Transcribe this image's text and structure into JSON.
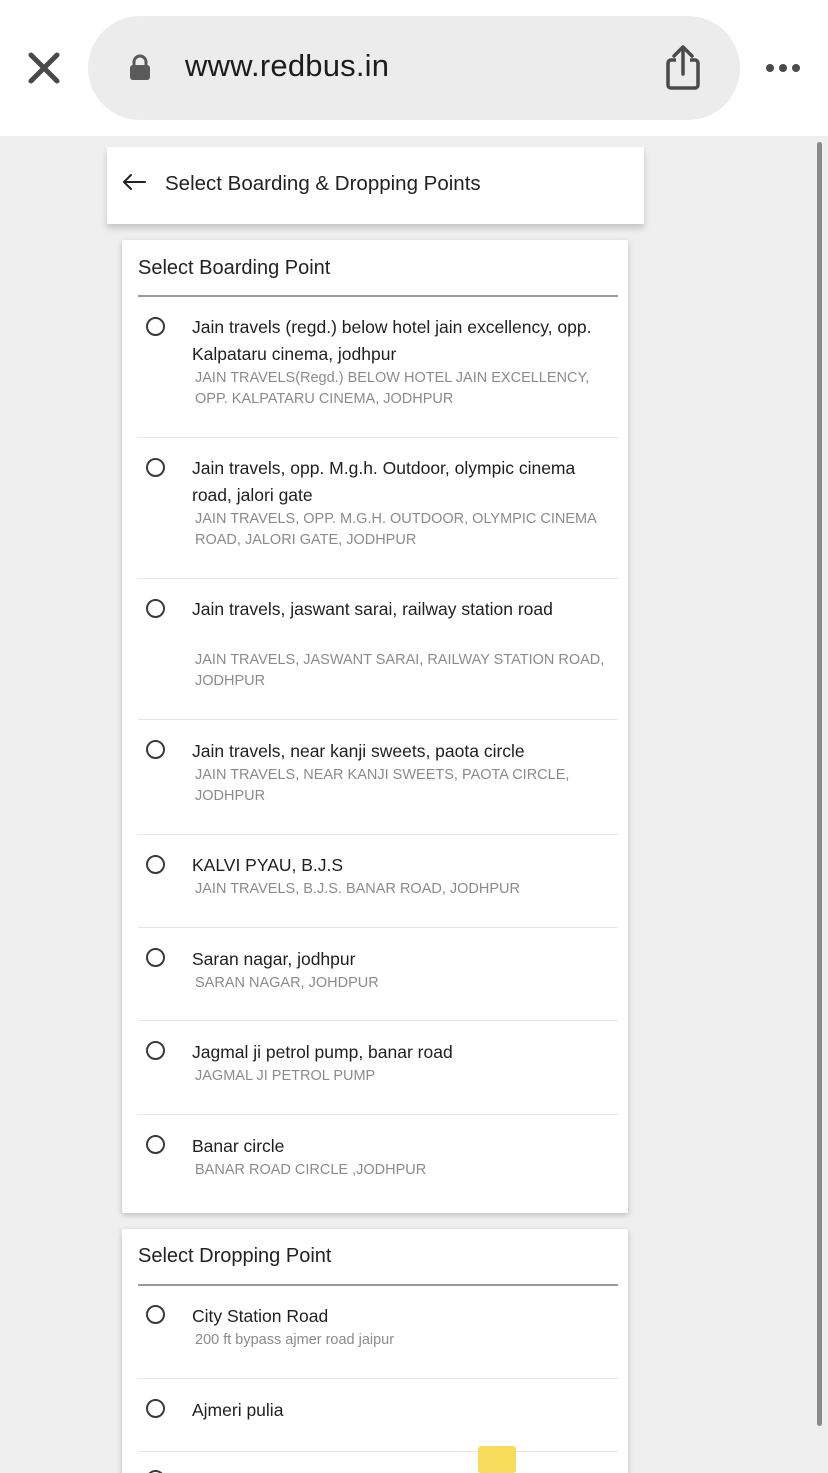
{
  "browser": {
    "url": "www.redbus.in",
    "icons": [
      "close-icon",
      "lock-icon",
      "share-icon",
      "more-icon"
    ]
  },
  "header": {
    "title": "Select Boarding & Dropping Points",
    "back_icon": "arrow-left-icon"
  },
  "boarding": {
    "title": "Select Boarding Point",
    "points": [
      {
        "name": "Jain travels (regd.) below hotel jain excellency, opp. Kalpataru cinema, jodhpur",
        "address": "JAIN TRAVELS(Regd.) BELOW HOTEL JAIN EXCELLENCY, OPP. KALPATARU CINEMA, JODHPUR"
      },
      {
        "name": "Jain travels, opp. M.g.h. Outdoor, olympic cinema road, jalori gate",
        "address": "JAIN TRAVELS, OPP. M.G.H. OUTDOOR, OLYMPIC CINEMA ROAD, JALORI GATE, JODHPUR"
      },
      {
        "name": "Jain travels, jaswant sarai, railway station road",
        "address": "JAIN TRAVELS, JASWANT SARAI, RAILWAY STATION ROAD, JODHPUR"
      },
      {
        "name": "Jain travels, near kanji sweets, paota circle",
        "address": "JAIN TRAVELS, NEAR KANJI SWEETS, PAOTA CIRCLE, JODHPUR"
      },
      {
        "name": "KALVI PYAU, B.J.S",
        "address": "JAIN TRAVELS, B.J.S. BANAR ROAD, JODHPUR"
      },
      {
        "name": "Saran nagar, jodhpur",
        "address": "SARAN NAGAR, JOHDPUR"
      },
      {
        "name": "Jagmal ji petrol pump, banar road",
        "address": "JAGMAL JI PETROL PUMP"
      },
      {
        "name": "Banar circle",
        "address": "BANAR ROAD CIRCLE ,JODHPUR"
      }
    ]
  },
  "dropping": {
    "title": "Select Dropping Point",
    "points": [
      {
        "name": "City Station Road",
        "address": "200 ft bypass ajmer road jaipur"
      },
      {
        "name": "Ajmeri pulia",
        "address": ""
      }
    ]
  }
}
